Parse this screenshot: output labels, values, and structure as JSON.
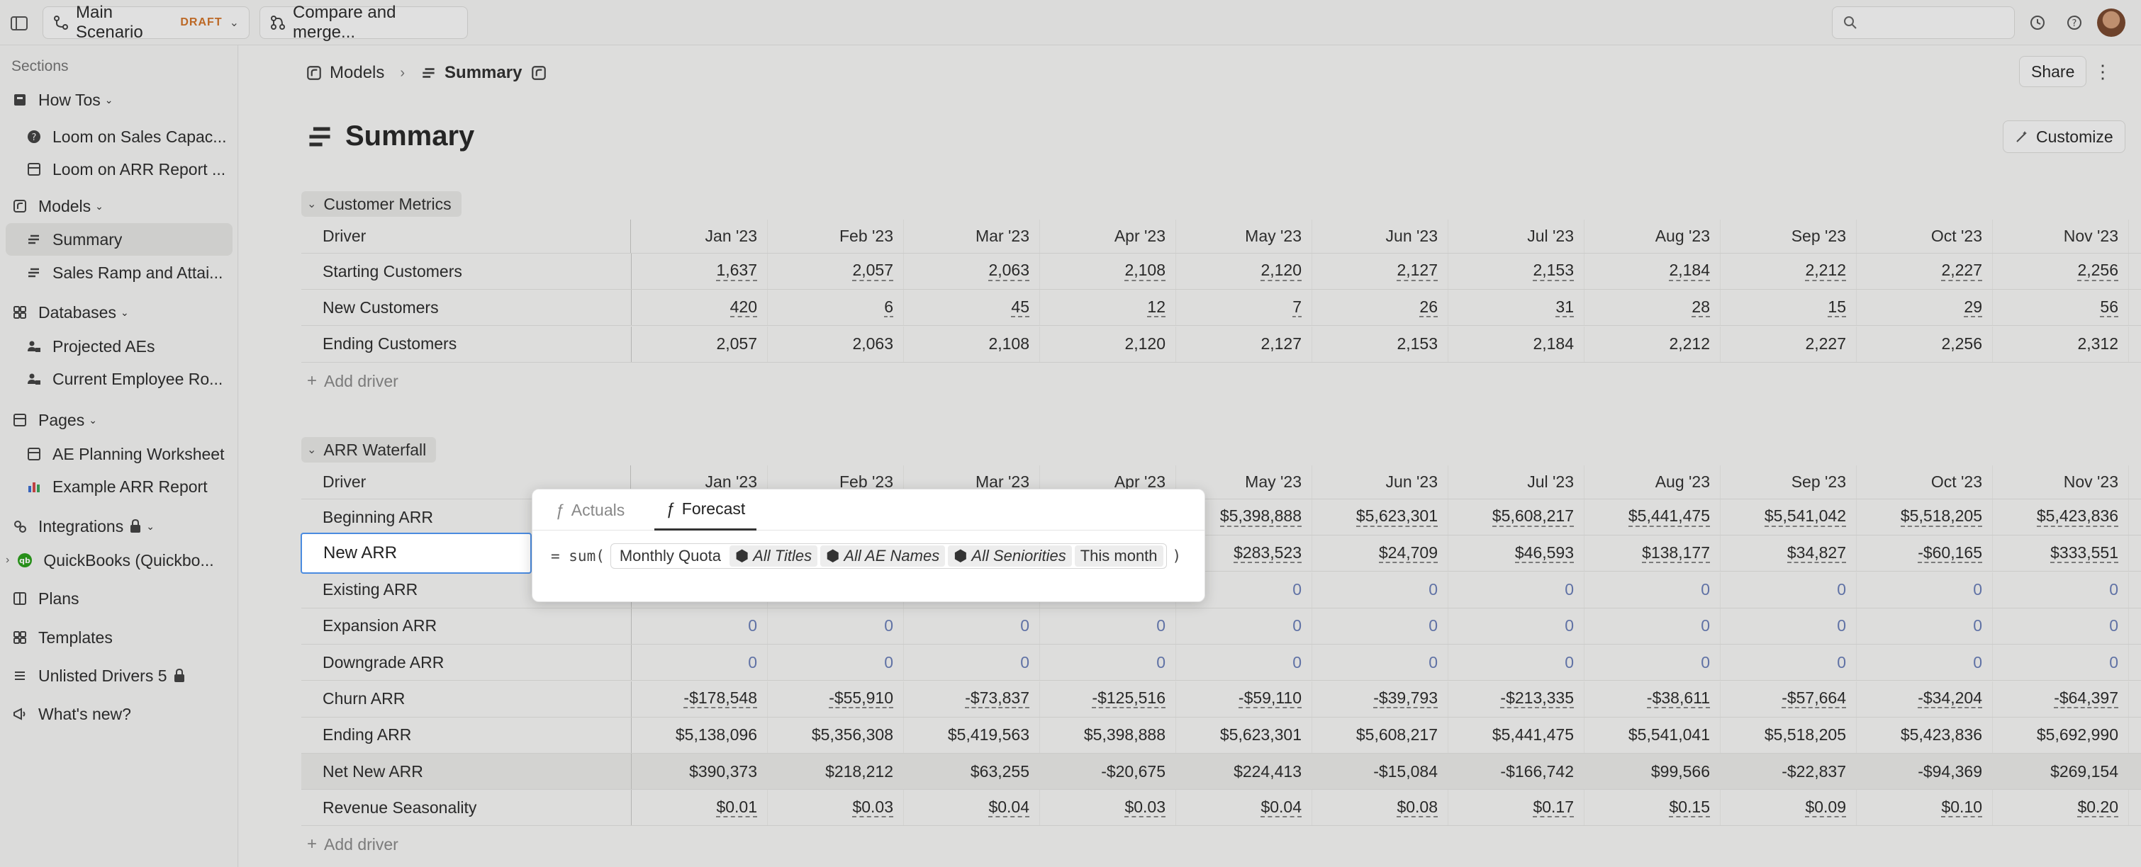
{
  "topbar": {
    "scenario_label": "Main Scenario",
    "scenario_badge": "DRAFT",
    "compare_label": "Compare and merge..."
  },
  "sidebar": {
    "sections_label": "Sections",
    "items": [
      {
        "label": "How Tos",
        "type": "section"
      },
      {
        "label": "Loom on Sales Capac...",
        "type": "child"
      },
      {
        "label": "Loom on ARR Report ...",
        "type": "child"
      },
      {
        "label": "Models",
        "type": "section"
      },
      {
        "label": "Summary",
        "type": "child",
        "active": true
      },
      {
        "label": "Sales Ramp and Attai...",
        "type": "child"
      },
      {
        "label": "Databases",
        "type": "section"
      },
      {
        "label": "Projected AEs",
        "type": "child"
      },
      {
        "label": "Current Employee Ro...",
        "type": "child"
      },
      {
        "label": "Pages",
        "type": "section"
      },
      {
        "label": "AE Planning Worksheet",
        "type": "child"
      },
      {
        "label": "Example ARR Report",
        "type": "child"
      },
      {
        "label": "Integrations",
        "type": "section"
      },
      {
        "label": "QuickBooks (Quickbo...",
        "type": "child"
      },
      {
        "label": "Plans",
        "type": "top"
      },
      {
        "label": "Templates",
        "type": "top"
      },
      {
        "label": "Unlisted Drivers 5",
        "type": "top"
      },
      {
        "label": "What's new?",
        "type": "top"
      }
    ]
  },
  "breadcrumb": {
    "parent": "Models",
    "current": "Summary"
  },
  "share_label": "Share",
  "page_title": "Summary",
  "customize_label": "Customize",
  "months": [
    "Jan '23",
    "Feb '23",
    "Mar '23",
    "Apr '23",
    "May '23",
    "Jun '23",
    "Jul '23",
    "Aug '23",
    "Sep '23",
    "Oct '23",
    "Nov '23"
  ],
  "customer_metrics": {
    "title": "Customer Metrics",
    "driver_header": "Driver",
    "rows": [
      {
        "name": "Starting Customers",
        "values": [
          "1,637",
          "2,057",
          "2,063",
          "2,108",
          "2,120",
          "2,127",
          "2,153",
          "2,184",
          "2,212",
          "2,227",
          "2,256"
        ],
        "dashed": true
      },
      {
        "name": "New Customers",
        "values": [
          "420",
          "6",
          "45",
          "12",
          "7",
          "26",
          "31",
          "28",
          "15",
          "29",
          "56"
        ],
        "dashed": true
      },
      {
        "name": "Ending Customers",
        "values": [
          "2,057",
          "2,063",
          "2,108",
          "2,120",
          "2,127",
          "2,153",
          "2,184",
          "2,212",
          "2,227",
          "2,256",
          "2,312"
        ],
        "dashed": false
      }
    ],
    "add_driver": "Add driver"
  },
  "arr_waterfall": {
    "title": "ARR Waterfall",
    "driver_header": "Driver",
    "rows": [
      {
        "name": "Beginning ARR",
        "values": [
          "",
          "",
          "",
          "",
          "$5,398,888",
          "$5,623,301",
          "$5,608,217",
          "$5,441,475",
          "$5,541,042",
          "$5,518,205",
          "$5,423,836"
        ],
        "dashed": true
      },
      {
        "name": "New ARR",
        "values": [
          "",
          "",
          "",
          "",
          "$283,523",
          "$24,709",
          "$46,593",
          "$138,177",
          "$34,827",
          "-$60,165",
          "$333,551"
        ],
        "dashed": true
      },
      {
        "name": "Existing ARR",
        "values": [
          "",
          "",
          "",
          "",
          "0",
          "0",
          "0",
          "0",
          "0",
          "0",
          "0"
        ],
        "dashed": false,
        "zero": true
      },
      {
        "name": "Expansion ARR",
        "values": [
          "0",
          "0",
          "0",
          "0",
          "0",
          "0",
          "0",
          "0",
          "0",
          "0",
          "0"
        ],
        "dashed": false,
        "zero": true
      },
      {
        "name": "Downgrade ARR",
        "values": [
          "0",
          "0",
          "0",
          "0",
          "0",
          "0",
          "0",
          "0",
          "0",
          "0",
          "0"
        ],
        "dashed": false,
        "zero": true
      },
      {
        "name": "Churn ARR",
        "values": [
          "-$178,548",
          "-$55,910",
          "-$73,837",
          "-$125,516",
          "-$59,110",
          "-$39,793",
          "-$213,335",
          "-$38,611",
          "-$57,664",
          "-$34,204",
          "-$64,397"
        ],
        "dashed": true
      },
      {
        "name": "Ending ARR",
        "values": [
          "$5,138,096",
          "$5,356,308",
          "$5,419,563",
          "$5,398,888",
          "$5,623,301",
          "$5,608,217",
          "$5,441,475",
          "$5,541,041",
          "$5,518,205",
          "$5,423,836",
          "$5,692,990"
        ],
        "dashed": false
      },
      {
        "name": "Net New ARR",
        "values": [
          "$390,373",
          "$218,212",
          "$63,255",
          "-$20,675",
          "$224,413",
          "-$15,084",
          "-$166,742",
          "$99,566",
          "-$22,837",
          "-$94,369",
          "$269,154"
        ],
        "dashed": false
      },
      {
        "name": "Revenue Seasonality",
        "values": [
          "$0.01",
          "$0.03",
          "$0.04",
          "$0.03",
          "$0.04",
          "$0.08",
          "$0.17",
          "$0.15",
          "$0.09",
          "$0.10",
          "$0.20"
        ],
        "dashed": true
      }
    ],
    "add_driver": "Add driver"
  },
  "popup": {
    "tabs": [
      "Actuals",
      "Forecast"
    ],
    "active_tab": "Forecast",
    "formula_prefix": "= sum(",
    "formula_suffix": ")",
    "driver": "Monthly Quota",
    "filters": [
      "All Titles",
      "All AE Names",
      "All Seniorities"
    ],
    "period": "This month"
  },
  "focused_cell": "New ARR"
}
